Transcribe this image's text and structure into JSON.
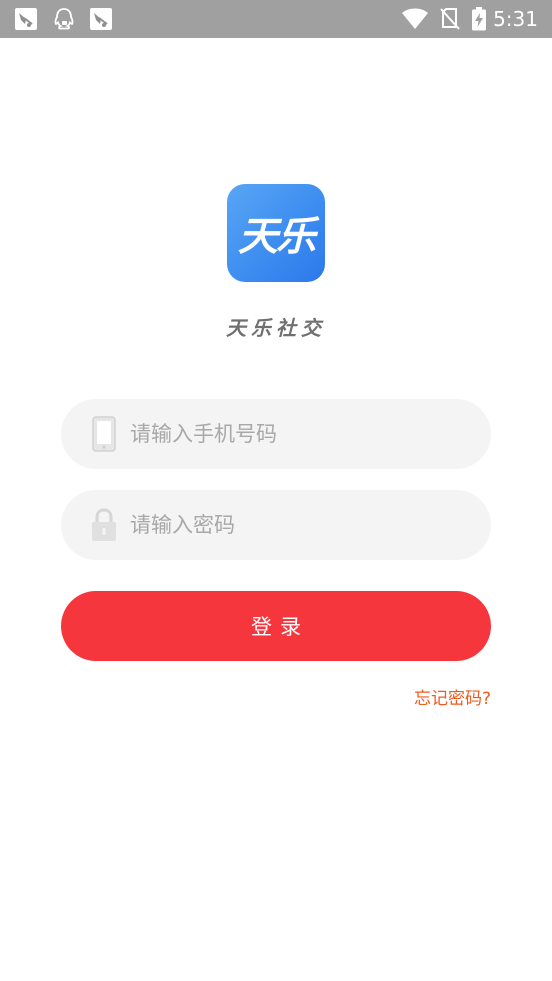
{
  "status_bar": {
    "time": "5:31",
    "notification_icons": [
      "app-notification-icon",
      "qq-notification-icon",
      "app-notification-icon"
    ],
    "system_icons": [
      "wifi-icon",
      "no-sim-icon",
      "battery-charging-icon"
    ]
  },
  "app": {
    "logo_text": "天乐",
    "name": "天乐社交"
  },
  "login_form": {
    "phone_placeholder": "请输入手机号码",
    "phone_value": "",
    "password_placeholder": "请输入密码",
    "password_value": "",
    "login_label": "登录",
    "forgot_label": "忘记密码?"
  },
  "colors": {
    "status_bar": "#a0a0a0",
    "logo_gradient_start": "#59a6f4",
    "logo_gradient_end": "#2b79ea",
    "field_background": "#f4f4f4",
    "primary": "#f5363d",
    "link": "#f05a1e",
    "placeholder": "#a8a8a8"
  }
}
